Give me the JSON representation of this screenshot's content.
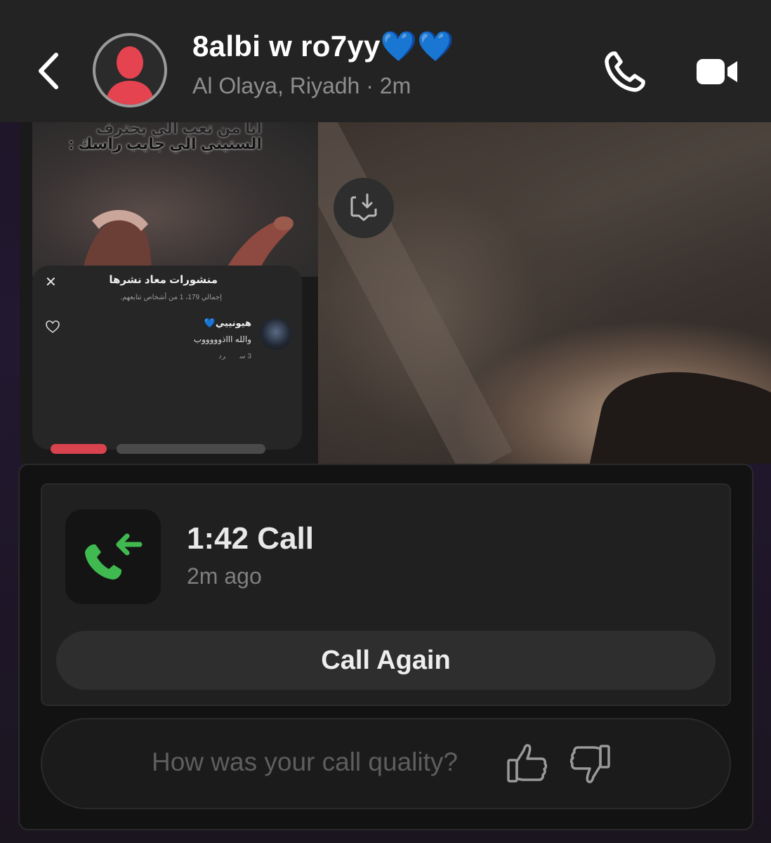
{
  "header": {
    "contact_name": "8albi w ro7yy💙💙",
    "location_status": "Al Olaya, Riyadh · 2m"
  },
  "shared_post": {
    "overlay_text_line1": "انا من تعب الي بحترف",
    "overlay_text_line2": "الستيني الي جايب راسك :",
    "sheet_title": "منشورات معاد نشرها",
    "sheet_subtitle": "إجمالي 179، 1 من أشخاص تتابعهم.",
    "close_symbol": "✕",
    "comment_user": "هيونييي💙",
    "comment_text": "والله اااذوووووب",
    "comment_age": "3 س",
    "comment_reply": "رد"
  },
  "call_card": {
    "title": "1:42 Call",
    "time_ago": "2m ago",
    "call_again_label": "Call Again",
    "icon": "incoming-call-icon",
    "icon_color": "#3fb950"
  },
  "feedback": {
    "prompt": "How was your call quality?",
    "up_icon": "thumbs-up-icon",
    "down_icon": "thumbs-down-icon"
  },
  "colors": {
    "header_bg": "#232323",
    "panel_bg": "#121212",
    "avatar_red": "#e5434f",
    "call_green": "#3fb950"
  }
}
